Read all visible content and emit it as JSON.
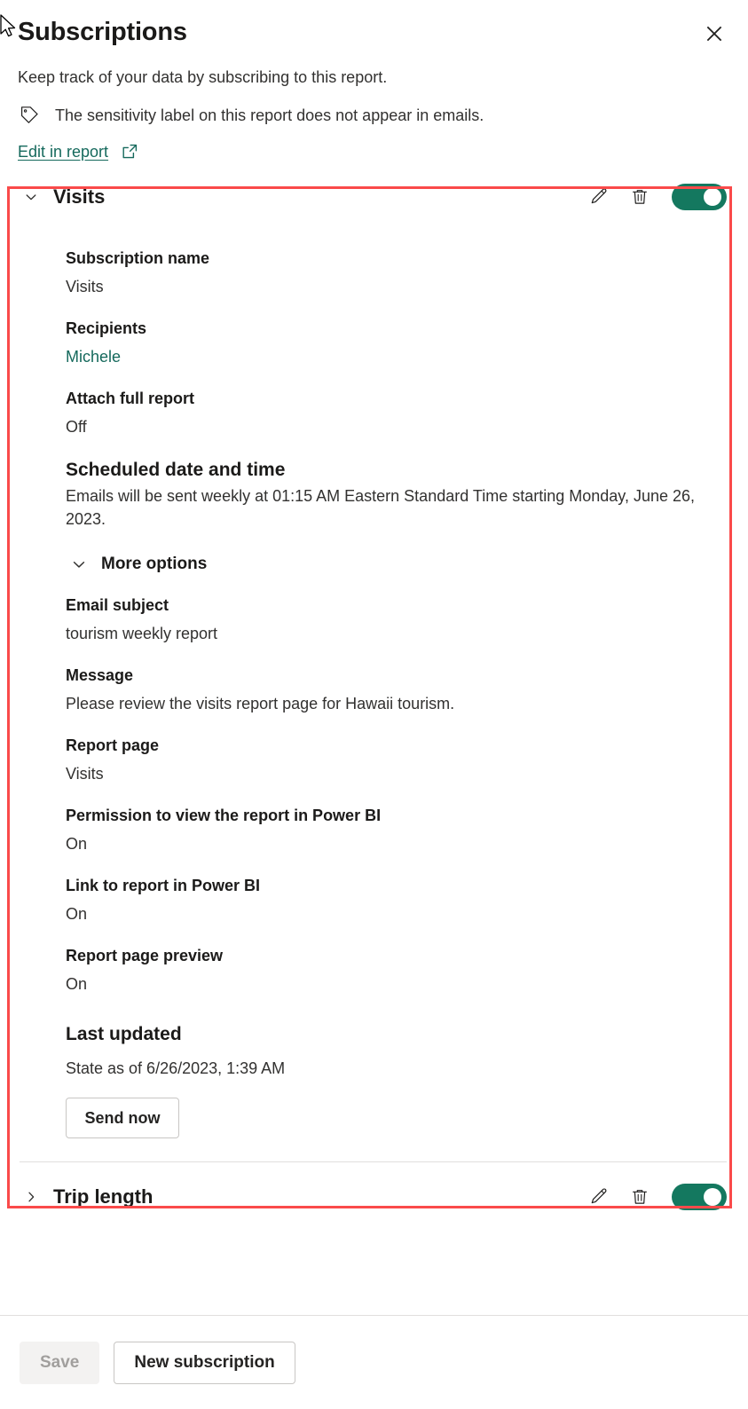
{
  "header": {
    "title": "Subscriptions",
    "close_label": "Close",
    "subtitle": "Keep track of your data by subscribing to this report.",
    "sensitivity_notice": "The sensitivity label on this report does not appear in emails.",
    "sensitivity_icon": "tag-icon",
    "edit_link": "Edit in report",
    "external_icon": "open-in-new-icon"
  },
  "colors": {
    "accent_teal": "#14785f",
    "link_teal": "#15695c",
    "highlight_red": "#fa4a4a",
    "text_primary": "#1b1a19",
    "text_secondary": "#323130",
    "disabled_text": "#a19f9d"
  },
  "subscriptions": [
    {
      "name": "Visits",
      "expanded": true,
      "chevron": "chevron-down-icon",
      "edit_icon": "pencil-icon",
      "delete_icon": "trash-icon",
      "toggle_state": "on",
      "fields": [
        {
          "label": "Subscription name",
          "value": "Visits",
          "style": "normal"
        },
        {
          "label": "Recipients",
          "value": "Michele",
          "style": "link"
        },
        {
          "label": "Attach full report",
          "value": "Off",
          "style": "normal"
        },
        {
          "label": "Scheduled date and time",
          "value": "Emails will be sent weekly at 01:15 AM Eastern Standard Time starting Monday, June 26, 2023.",
          "style": "big"
        }
      ],
      "more_options": {
        "label": "More options",
        "chevron": "chevron-down-icon",
        "expanded": true,
        "fields": [
          {
            "label": "Email subject",
            "value": "tourism weekly report"
          },
          {
            "label": "Message",
            "value": "Please review the visits report page for Hawaii tourism."
          },
          {
            "label": "Report page",
            "value": "Visits"
          },
          {
            "label": "Permission to view the report in Power BI",
            "value": "On"
          },
          {
            "label": "Link to report in Power BI",
            "value": "On"
          },
          {
            "label": "Report page preview",
            "value": "On"
          }
        ]
      },
      "last_updated": {
        "label": "Last updated",
        "value": "State as of 6/26/2023, 1:39 AM"
      },
      "send_now_label": "Send now"
    },
    {
      "name": "Trip length",
      "expanded": false,
      "chevron": "chevron-right-icon",
      "edit_icon": "pencil-icon",
      "delete_icon": "trash-icon",
      "toggle_state": "on"
    }
  ],
  "footer": {
    "save_label": "Save",
    "save_disabled": true,
    "new_subscription_label": "New subscription"
  }
}
